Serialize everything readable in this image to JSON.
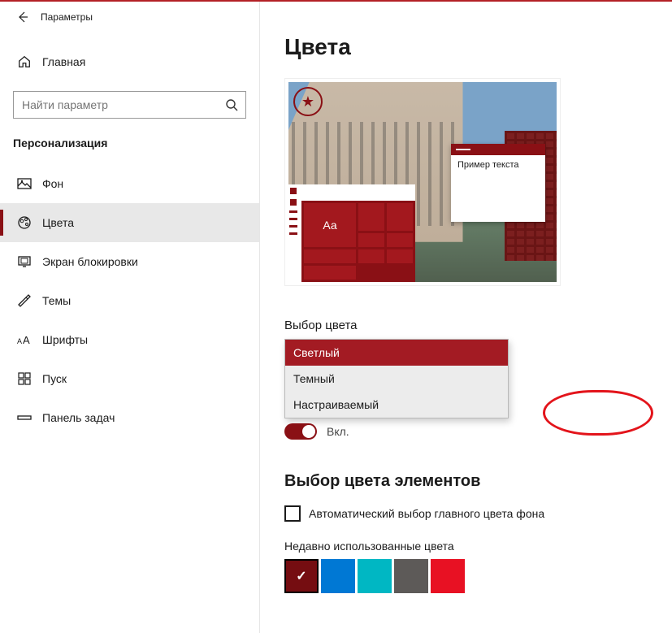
{
  "window": {
    "title": "Параметры"
  },
  "sidebar": {
    "home": "Главная",
    "searchPlaceholder": "Найти параметр",
    "group": "Персонализация",
    "items": [
      {
        "label": "Фон"
      },
      {
        "label": "Цвета"
      },
      {
        "label": "Экран блокировки"
      },
      {
        "label": "Темы"
      },
      {
        "label": "Шрифты"
      },
      {
        "label": "Пуск"
      },
      {
        "label": "Панель задач"
      }
    ],
    "activeIndex": 1
  },
  "page": {
    "title": "Цвета",
    "sampleText": "Пример текста",
    "aa": "Аа",
    "chooseColorLabel": "Выбор цвета",
    "chooseColorOptions": [
      "Светлый",
      "Темный",
      "Настраиваемый"
    ],
    "chooseColorSelectedIndex": 0,
    "toggle": {
      "on": true,
      "label": "Вкл."
    },
    "accentHeader": "Выбор цвета элементов",
    "autoPick": "Автоматический выбор главного цвета фона",
    "recentLabel": "Недавно использованные цвета",
    "recentColors": [
      "#8a1015",
      "#0078d4",
      "#00b7c3",
      "#5d5a58",
      "#e81123"
    ],
    "recentSelectedIndex": 0
  }
}
